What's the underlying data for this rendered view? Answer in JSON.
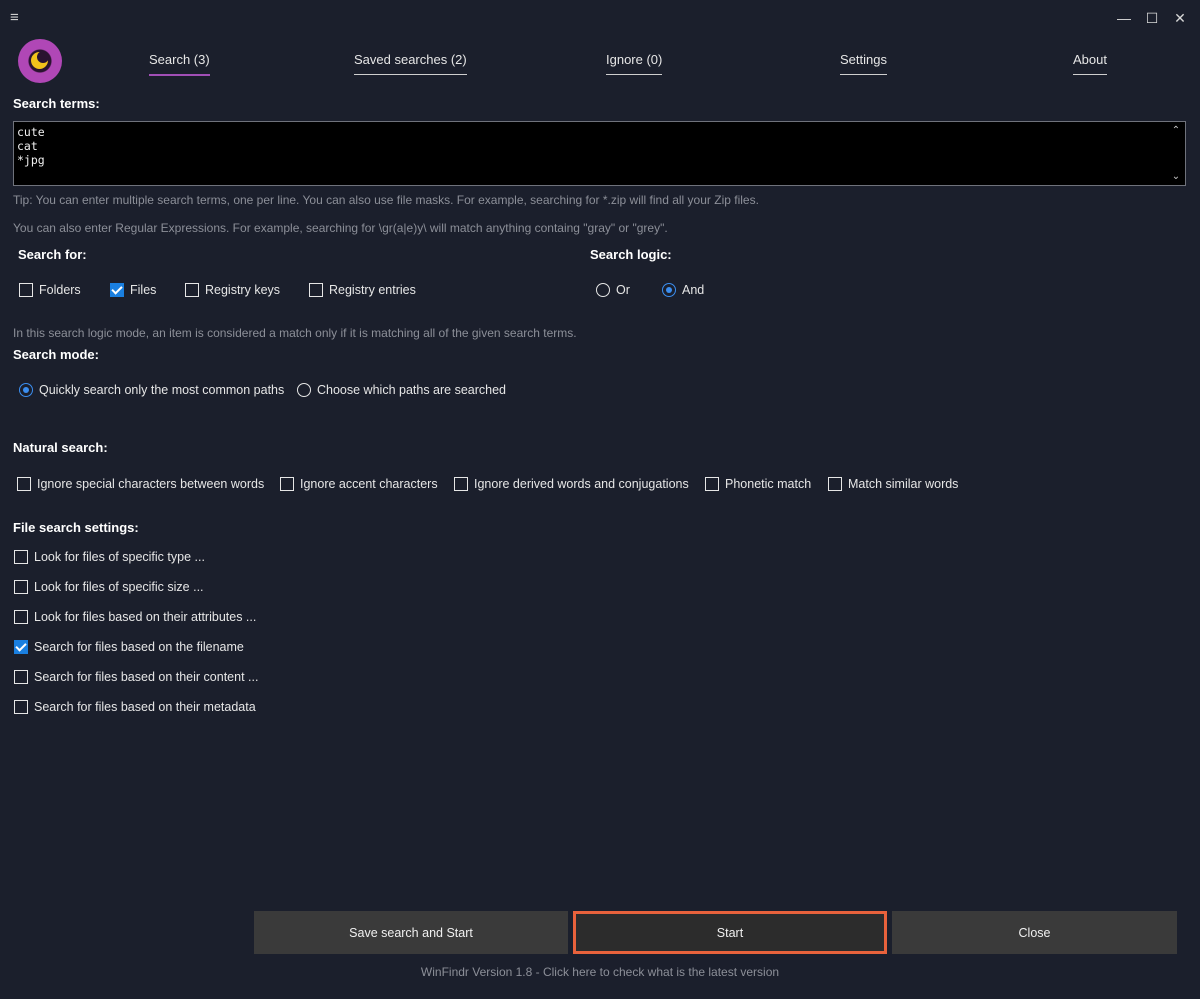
{
  "titlebar": {
    "menu_glyph": "≡",
    "minimize_glyph": "—",
    "maximize_glyph": "☐",
    "close_glyph": "✕"
  },
  "nav": {
    "tabs": [
      {
        "label": "Search (3)",
        "active": true
      },
      {
        "label": "Saved searches (2)",
        "active": false
      },
      {
        "label": "Ignore (0)",
        "active": false
      },
      {
        "label": "Settings",
        "active": false
      },
      {
        "label": "About",
        "active": false
      }
    ]
  },
  "search_terms": {
    "heading": "Search terms:",
    "lines": [
      "cute",
      "cat",
      "*jpg"
    ],
    "tip1": "Tip: You can enter multiple search terms, one per line. You can also use file masks. For example, searching for *.zip will find all your Zip files.",
    "tip2": "You can also enter Regular Expressions. For example, searching for \\gr(a|e)y\\ will match anything containg \"gray\" or \"grey\"."
  },
  "search_for": {
    "heading": "Search for:",
    "options": [
      {
        "label": "Folders",
        "checked": false
      },
      {
        "label": "Files",
        "checked": true
      },
      {
        "label": "Registry keys",
        "checked": false
      },
      {
        "label": "Registry entries",
        "checked": false
      }
    ]
  },
  "search_logic": {
    "heading": "Search logic:",
    "options": [
      {
        "label": "Or",
        "selected": false
      },
      {
        "label": "And",
        "selected": true
      }
    ],
    "note": "In this search logic mode, an item is considered a match only if it is matching all of the given search terms."
  },
  "search_mode": {
    "heading": "Search mode:",
    "options": [
      {
        "label": "Quickly search only the most common paths",
        "selected": true
      },
      {
        "label": "Choose which paths are searched",
        "selected": false
      }
    ]
  },
  "natural_search": {
    "heading": "Natural search:",
    "options": [
      {
        "label": "Ignore special characters between words",
        "checked": false
      },
      {
        "label": "Ignore accent characters",
        "checked": false
      },
      {
        "label": "Ignore derived words and conjugations",
        "checked": false
      },
      {
        "label": "Phonetic match",
        "checked": false
      },
      {
        "label": "Match similar words",
        "checked": false
      }
    ]
  },
  "file_search_settings": {
    "heading": "File search settings:",
    "options": [
      {
        "label": "Look for files of specific type ...",
        "checked": false
      },
      {
        "label": "Look for files of specific size ...",
        "checked": false
      },
      {
        "label": "Look for files based on their attributes ...",
        "checked": false
      },
      {
        "label": "Search for files based on the filename",
        "checked": true
      },
      {
        "label": "Search for files based on their content ...",
        "checked": false
      },
      {
        "label": "Search for files based on their metadata",
        "checked": false
      }
    ]
  },
  "buttons": {
    "save_and_start": "Save search and Start",
    "start": "Start",
    "close": "Close"
  },
  "footer": {
    "version_text": "WinFindr Version 1.8 - Click here to check what is the latest version"
  },
  "colors": {
    "background": "#1b1f2c",
    "accent": "#a14fb6",
    "check": "#1a7fe0",
    "primary_border": "#e8623c"
  }
}
